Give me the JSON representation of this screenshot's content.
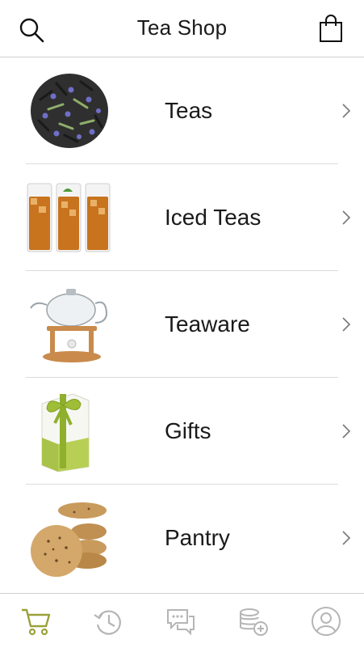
{
  "header": {
    "title": "Tea Shop",
    "search_icon": "search-icon",
    "bag_icon": "shopping-bag-icon"
  },
  "categories": [
    {
      "label": "Teas",
      "image": "loose-leaf-tea-image"
    },
    {
      "label": "Iced Teas",
      "image": "iced-tea-glasses-image"
    },
    {
      "label": "Teaware",
      "image": "glass-teapot-on-warmer-image"
    },
    {
      "label": "Gifts",
      "image": "gift-box-with-ribbon-image"
    },
    {
      "label": "Pantry",
      "image": "cookies-image"
    }
  ],
  "tabbar": {
    "tabs": [
      {
        "icon": "cart-icon",
        "active": true
      },
      {
        "icon": "history-icon",
        "active": false
      },
      {
        "icon": "chat-bubbles-icon",
        "active": false
      },
      {
        "icon": "coins-add-icon",
        "active": false
      },
      {
        "icon": "account-icon",
        "active": false
      }
    ],
    "active_color": "#9aa13a",
    "inactive_color": "#b5b5b5"
  }
}
